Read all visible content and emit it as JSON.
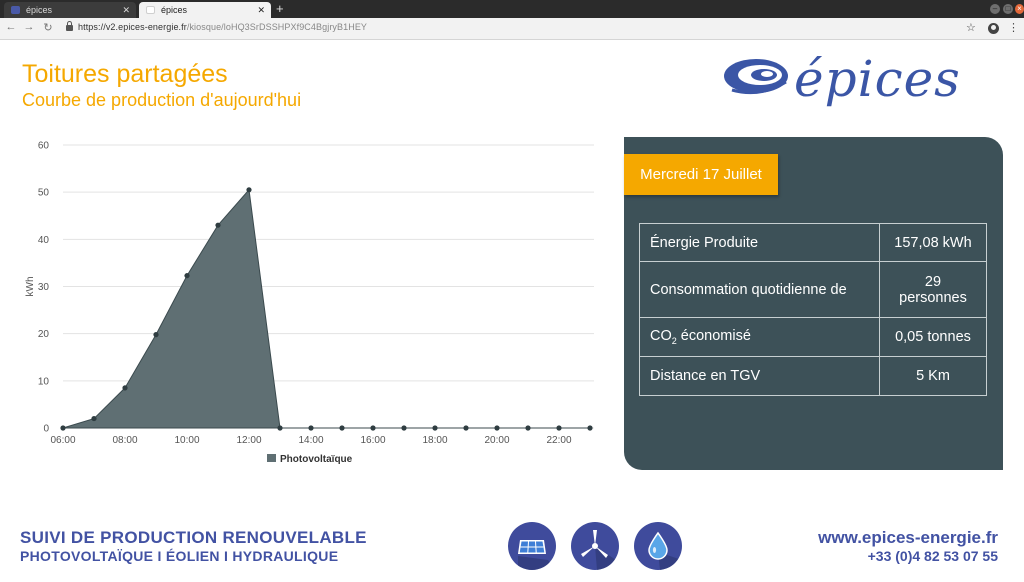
{
  "browser": {
    "tabs": [
      {
        "title": "épices",
        "active": false
      },
      {
        "title": "épices",
        "active": true
      }
    ],
    "url_host": "https://v2.epices-energie.fr",
    "url_path": "/kiosque/loHQ3SrDSSHPXf9C4BgjryB1HEY"
  },
  "header": {
    "title": "Toitures partagées",
    "subtitle": "Courbe de production d'aujourd'hui",
    "logo_text": "épices"
  },
  "chart_data": {
    "type": "area",
    "ylabel": "kWh",
    "xlabel": "",
    "ylim": [
      0,
      60
    ],
    "yticks": [
      0,
      10,
      20,
      30,
      40,
      50,
      60
    ],
    "x": [
      "06:00",
      "07:00",
      "08:00",
      "09:00",
      "10:00",
      "11:00",
      "12:00",
      "13:00",
      "14:00",
      "15:00",
      "16:00",
      "17:00",
      "18:00",
      "19:00",
      "20:00",
      "21:00",
      "22:00",
      "23:00"
    ],
    "xtick_labels": [
      "06:00",
      "08:00",
      "10:00",
      "12:00",
      "14:00",
      "16:00",
      "18:00",
      "20:00",
      "22:00"
    ],
    "series": [
      {
        "name": "Photovoltaïque",
        "color": "#5f6f73",
        "values": [
          0,
          2,
          8.5,
          19.8,
          32.3,
          43,
          50.5,
          0,
          0,
          0,
          0,
          0,
          0,
          0,
          0,
          0,
          0,
          0
        ]
      }
    ],
    "grid": true,
    "legend": "bottom"
  },
  "panel": {
    "date": "Mercredi 17 Juillet",
    "rows": [
      {
        "label": "Énergie Produite",
        "value": "157,08 kWh"
      },
      {
        "label": "Consommation quotidienne de",
        "value_line1": "29",
        "value_line2": "personnes"
      },
      {
        "label_main": "CO",
        "label_sub": "2",
        "label_rest": " économisé",
        "value": "0,05 tonnes"
      },
      {
        "label": "Distance en TGV",
        "value": "5 Km"
      }
    ]
  },
  "footer": {
    "line1": "SUIVI DE PRODUCTION RENOUVELABLE",
    "line2": "PHOTOVOLTAÏQUE I ÉOLIEN I HYDRAULIQUE",
    "website": "www.epices-energie.fr",
    "phone": "+33 (0)4 82 53 07 55",
    "icons": [
      "solar-panel-icon",
      "wind-turbine-icon",
      "water-drop-icon"
    ]
  },
  "colors": {
    "accent_orange": "#f5a800",
    "brand_blue": "#3b56a6",
    "panel_bg": "#3d5158",
    "area_fill": "#5f6f73"
  }
}
